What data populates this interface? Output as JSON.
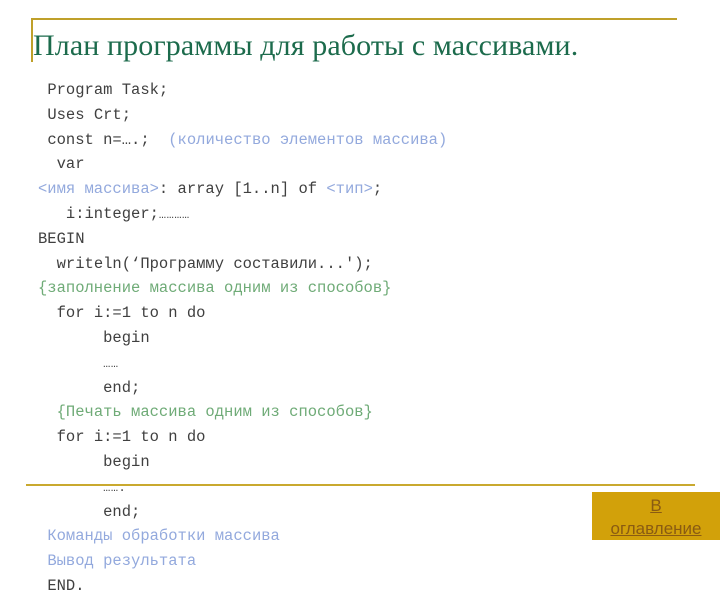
{
  "slide": {
    "title": "План программы для работы с массивами.",
    "title_color": "#1c6b4c",
    "accent_color": "#bfa02a",
    "background": "#ffffff"
  },
  "code": {
    "comment_color": "#6fab77",
    "placeholder_color": "#93a9dd",
    "text_color": "#404040",
    "lines": [
      {
        "indent": 1,
        "segments": [
          {
            "text": "Program Task;",
            "style": "code"
          }
        ]
      },
      {
        "indent": 1,
        "segments": [
          {
            "text": "Uses Crt;",
            "style": "code"
          }
        ]
      },
      {
        "indent": 1,
        "segments": [
          {
            "text": "const n=….;  ",
            "style": "code"
          },
          {
            "text": "(количество элементов массива)",
            "style": "blue"
          }
        ]
      },
      {
        "indent": 2,
        "segments": [
          {
            "text": "var",
            "style": "code"
          }
        ]
      },
      {
        "indent": 0,
        "segments": [
          {
            "text": "<имя массива>",
            "style": "blue"
          },
          {
            "text": ": array [1..n] of ",
            "style": "code"
          },
          {
            "text": "<тип>",
            "style": "blue"
          },
          {
            "text": ";",
            "style": "code"
          }
        ]
      },
      {
        "indent": 3,
        "segments": [
          {
            "text": "i:integer;",
            "style": "code"
          },
          {
            "text": "…………",
            "style": "dots"
          }
        ]
      },
      {
        "indent": 0,
        "segments": [
          {
            "text": "BEGIN",
            "style": "code"
          }
        ]
      },
      {
        "indent": 2,
        "segments": [
          {
            "text": "writeln(‘Программу составили...');",
            "style": "code"
          }
        ]
      },
      {
        "indent": 0,
        "segments": [
          {
            "text": "{заполнение массива одним из способов}",
            "style": "green"
          }
        ]
      },
      {
        "indent": 2,
        "segments": [
          {
            "text": "for i:=1 to n do",
            "style": "code"
          }
        ]
      },
      {
        "indent": 7,
        "segments": [
          {
            "text": "begin",
            "style": "code"
          }
        ]
      },
      {
        "indent": 7,
        "segments": [
          {
            "text": "……",
            "style": "dots"
          }
        ]
      },
      {
        "indent": 7,
        "segments": [
          {
            "text": "end;",
            "style": "code"
          }
        ]
      },
      {
        "indent": 2,
        "segments": [
          {
            "text": "{Печать массива одним из способов}",
            "style": "green"
          }
        ]
      },
      {
        "indent": 2,
        "segments": [
          {
            "text": "for i:=1 to n do",
            "style": "code"
          }
        ]
      },
      {
        "indent": 7,
        "segments": [
          {
            "text": "begin",
            "style": "code"
          }
        ]
      },
      {
        "indent": 7,
        "segments": [
          {
            "text": "…….",
            "style": "dots"
          }
        ]
      },
      {
        "indent": 7,
        "segments": [
          {
            "text": "end;",
            "style": "code"
          }
        ]
      },
      {
        "indent": 1,
        "segments": [
          {
            "text": "Команды обработки массива",
            "style": "blue"
          }
        ]
      },
      {
        "indent": 1,
        "segments": [
          {
            "text": "Вывод результата",
            "style": "blue"
          }
        ]
      },
      {
        "indent": 1,
        "segments": [
          {
            "text": "END.",
            "style": "code"
          }
        ]
      }
    ]
  },
  "toc_button": {
    "line1": "В",
    "line2": "оглавление",
    "background": "#d2a10a",
    "text_color": "#8a5b12"
  }
}
